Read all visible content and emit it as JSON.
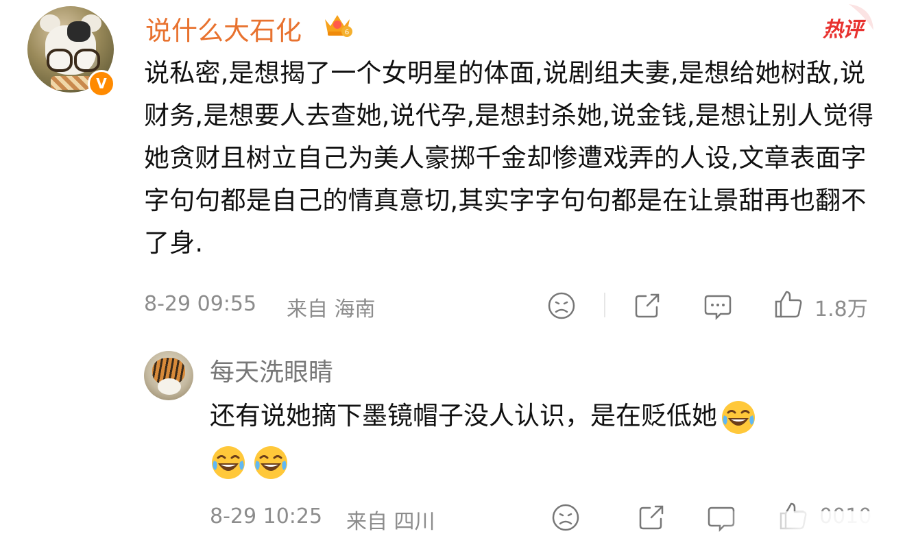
{
  "main_comment": {
    "username": "说什么大石化",
    "verified_badge": "V",
    "hot_label": "热评",
    "text": "说私密,是想揭了一个女明星的体面,说剧组夫妻,是想给她树敌,说财务,是想要人去查她,说代孕,是想封杀她,说金钱,是想让别人觉得她贪财且树立自己为美人豪掷千金却惨遭戏弄的人设,文章表面字字句句都是自己的情真意切,其实字字句句都是在让景甜再也翻不了身.",
    "timestamp": "8-29 09:55",
    "location": "来自 海南",
    "like_count": "1.8万",
    "icons": [
      "dislike-icon",
      "share-icon",
      "comment-icon",
      "like-icon"
    ]
  },
  "reply": {
    "username": "每天洗眼睛",
    "text": "还有说她摘下墨镜帽子没人认识，是在贬低她",
    "emoji": "tears-of-joy-emoji",
    "timestamp": "8-29 10:25",
    "location": "来自 四川",
    "like_count_partial": "0010",
    "icons": [
      "dislike-icon",
      "share-icon",
      "comment-icon",
      "like-icon"
    ]
  },
  "colors": {
    "username_main": "#e8722f",
    "hot_label": "#e8322f",
    "meta_text": "#8c8c8c",
    "verified_badge": "#ff8a00"
  }
}
